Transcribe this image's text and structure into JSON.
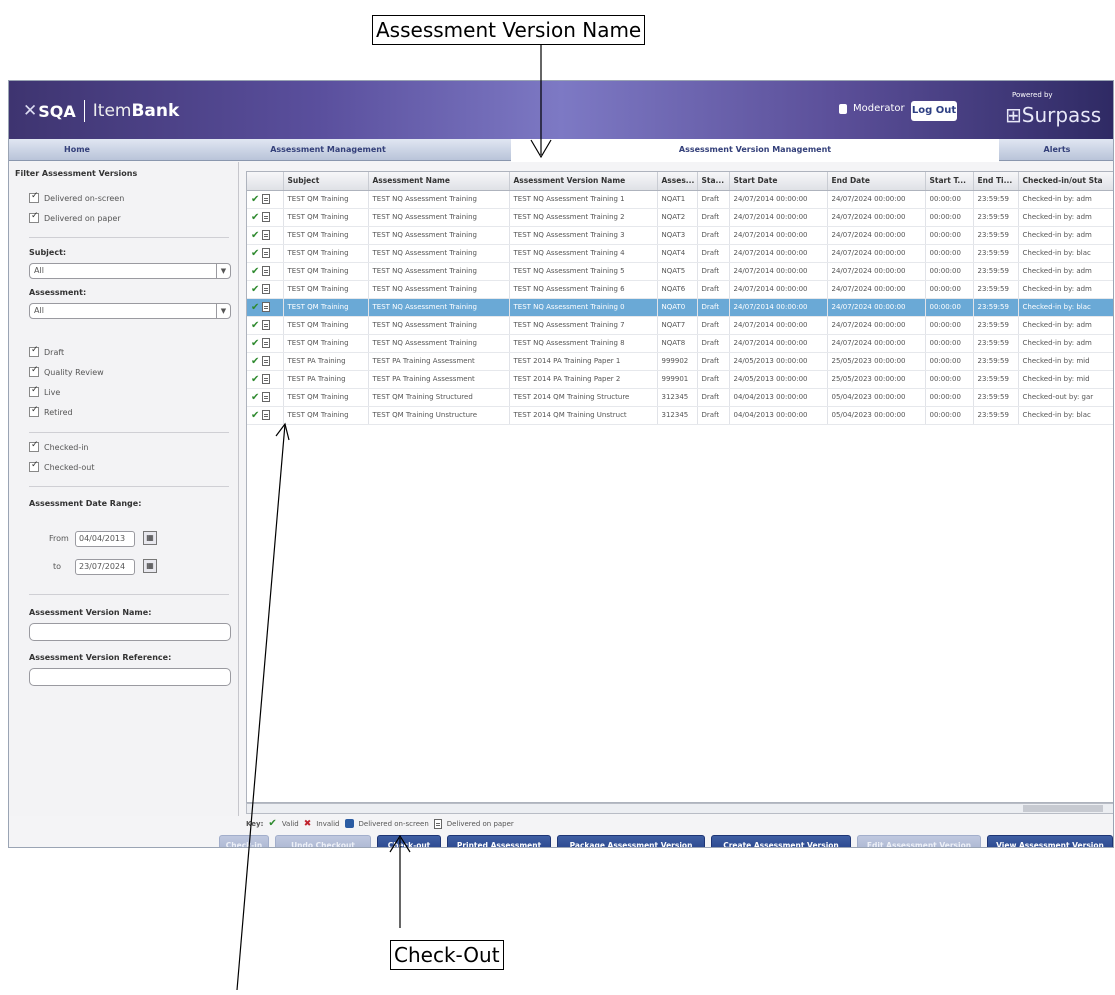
{
  "annotations": {
    "top_callout": "Assessment Version Name",
    "bottom_callout": "Check-Out"
  },
  "header": {
    "logo_x": "✕",
    "logo_org": "SQA",
    "logo_item": "Item",
    "logo_bank": "Bank",
    "username": "Moderator",
    "logout_label": "Log Out",
    "powered_by": "Powered by",
    "brand": "Surpass"
  },
  "tabs": [
    {
      "label": "Home"
    },
    {
      "label": "Assessment Management"
    },
    {
      "label": "Assessment Version Management"
    },
    {
      "label": "Alerts"
    }
  ],
  "sidebar": {
    "title": "Filter Assessment Versions",
    "delivery": [
      "Delivered on-screen",
      "Delivered on paper"
    ],
    "subject_label": "Subject:",
    "subject_value": "All",
    "assessment_label": "Assessment:",
    "assessment_value": "All",
    "status": [
      "Draft",
      "Quality Review",
      "Live",
      "Retired"
    ],
    "checked": [
      "Checked-in",
      "Checked-out"
    ],
    "date_range_label": "Assessment Date Range:",
    "from_label": "From",
    "from_value": "04/04/2013",
    "to_label": "to",
    "to_value": "23/07/2024",
    "version_name_label": "Assessment Version Name:",
    "version_ref_label": "Assessment Version Reference:"
  },
  "grid": {
    "columns": [
      "",
      "Subject",
      "Assessment Name",
      "Assessment Version Name",
      "Asses...",
      "Sta...",
      "Start Date",
      "End Date",
      "Start T...",
      "End Ti...",
      "Checked-in/out Sta"
    ],
    "rows": [
      [
        "TEST QM Training",
        "TEST NQ Assessment Training",
        "TEST NQ Assessment Training 1",
        "NQAT1",
        "Draft",
        "24/07/2014 00:00:00",
        "24/07/2024 00:00:00",
        "00:00:00",
        "23:59:59",
        "Checked-in by: adm"
      ],
      [
        "TEST QM Training",
        "TEST NQ Assessment Training",
        "TEST NQ Assessment Training 2",
        "NQAT2",
        "Draft",
        "24/07/2014 00:00:00",
        "24/07/2024 00:00:00",
        "00:00:00",
        "23:59:59",
        "Checked-in by: adm"
      ],
      [
        "TEST QM Training",
        "TEST NQ Assessment Training",
        "TEST NQ Assessment Training 3",
        "NQAT3",
        "Draft",
        "24/07/2014 00:00:00",
        "24/07/2024 00:00:00",
        "00:00:00",
        "23:59:59",
        "Checked-in by: adm"
      ],
      [
        "TEST QM Training",
        "TEST NQ Assessment Training",
        "TEST NQ Assessment Training 4",
        "NQAT4",
        "Draft",
        "24/07/2014 00:00:00",
        "24/07/2024 00:00:00",
        "00:00:00",
        "23:59:59",
        "Checked-in by: blac"
      ],
      [
        "TEST QM Training",
        "TEST NQ Assessment Training",
        "TEST NQ Assessment Training 5",
        "NQAT5",
        "Draft",
        "24/07/2014 00:00:00",
        "24/07/2024 00:00:00",
        "00:00:00",
        "23:59:59",
        "Checked-in by: adm"
      ],
      [
        "TEST QM Training",
        "TEST NQ Assessment Training",
        "TEST NQ Assessment Training 6",
        "NQAT6",
        "Draft",
        "24/07/2014 00:00:00",
        "24/07/2024 00:00:00",
        "00:00:00",
        "23:59:59",
        "Checked-in by: adm"
      ],
      [
        "TEST QM Training",
        "TEST NQ Assessment Training",
        "TEST NQ Assessment Training 0",
        "NQAT0",
        "Draft",
        "24/07/2014 00:00:00",
        "24/07/2024 00:00:00",
        "00:00:00",
        "23:59:59",
        "Checked-in by: blac"
      ],
      [
        "TEST QM Training",
        "TEST NQ Assessment Training",
        "TEST NQ Assessment Training 7",
        "NQAT7",
        "Draft",
        "24/07/2014 00:00:00",
        "24/07/2024 00:00:00",
        "00:00:00",
        "23:59:59",
        "Checked-in by: adm"
      ],
      [
        "TEST QM Training",
        "TEST NQ Assessment Training",
        "TEST NQ Assessment Training 8",
        "NQAT8",
        "Draft",
        "24/07/2014 00:00:00",
        "24/07/2024 00:00:00",
        "00:00:00",
        "23:59:59",
        "Checked-in by: adm"
      ],
      [
        "TEST PA Training",
        "TEST PA Training Assessment",
        "TEST 2014 PA Training Paper 1",
        "999902",
        "Draft",
        "24/05/2013 00:00:00",
        "25/05/2023 00:00:00",
        "00:00:00",
        "23:59:59",
        "Checked-in by: mid"
      ],
      [
        "TEST PA Training",
        "TEST PA Training Assessment",
        "TEST 2014 PA Training Paper 2",
        "999901",
        "Draft",
        "24/05/2013 00:00:00",
        "25/05/2023 00:00:00",
        "00:00:00",
        "23:59:59",
        "Checked-in by: mid"
      ],
      [
        "TEST QM Training",
        "TEST QM Training Structured",
        "TEST 2014 QM Training Structure",
        "312345",
        "Draft",
        "04/04/2013 00:00:00",
        "05/04/2023 00:00:00",
        "00:00:00",
        "23:59:59",
        "Checked-out by: gar"
      ],
      [
        "TEST QM Training",
        "TEST QM Training Unstructure",
        "TEST 2014 QM Training Unstruct",
        "312345",
        "Draft",
        "04/04/2013 00:00:00",
        "05/04/2023 00:00:00",
        "00:00:00",
        "23:59:59",
        "Checked-in by: blac"
      ]
    ],
    "selected_row": 6
  },
  "key": {
    "label": "Key:",
    "valid": "Valid",
    "invalid": "Invalid",
    "onscreen": "Delivered on-screen",
    "paper": "Delivered on paper"
  },
  "buttons": [
    {
      "label": "Check-in",
      "enabled": false
    },
    {
      "label": "Undo Checkout",
      "enabled": false
    },
    {
      "label": "Check-out",
      "enabled": true
    },
    {
      "label": "Printed Assessment",
      "enabled": true
    },
    {
      "label": "Package Assessment Version",
      "enabled": true
    },
    {
      "label": "Create Assessment Version",
      "enabled": true
    },
    {
      "label": "Edit Assessment Version",
      "enabled": false
    },
    {
      "label": "View Assessment Version",
      "enabled": true
    }
  ],
  "colors": {
    "header_purple": "#5a4f9d",
    "selected_row": "#6aa9d6",
    "button_blue": "#25418a",
    "valid_green": "#2f8a2f",
    "invalid_red": "#c0222d"
  }
}
